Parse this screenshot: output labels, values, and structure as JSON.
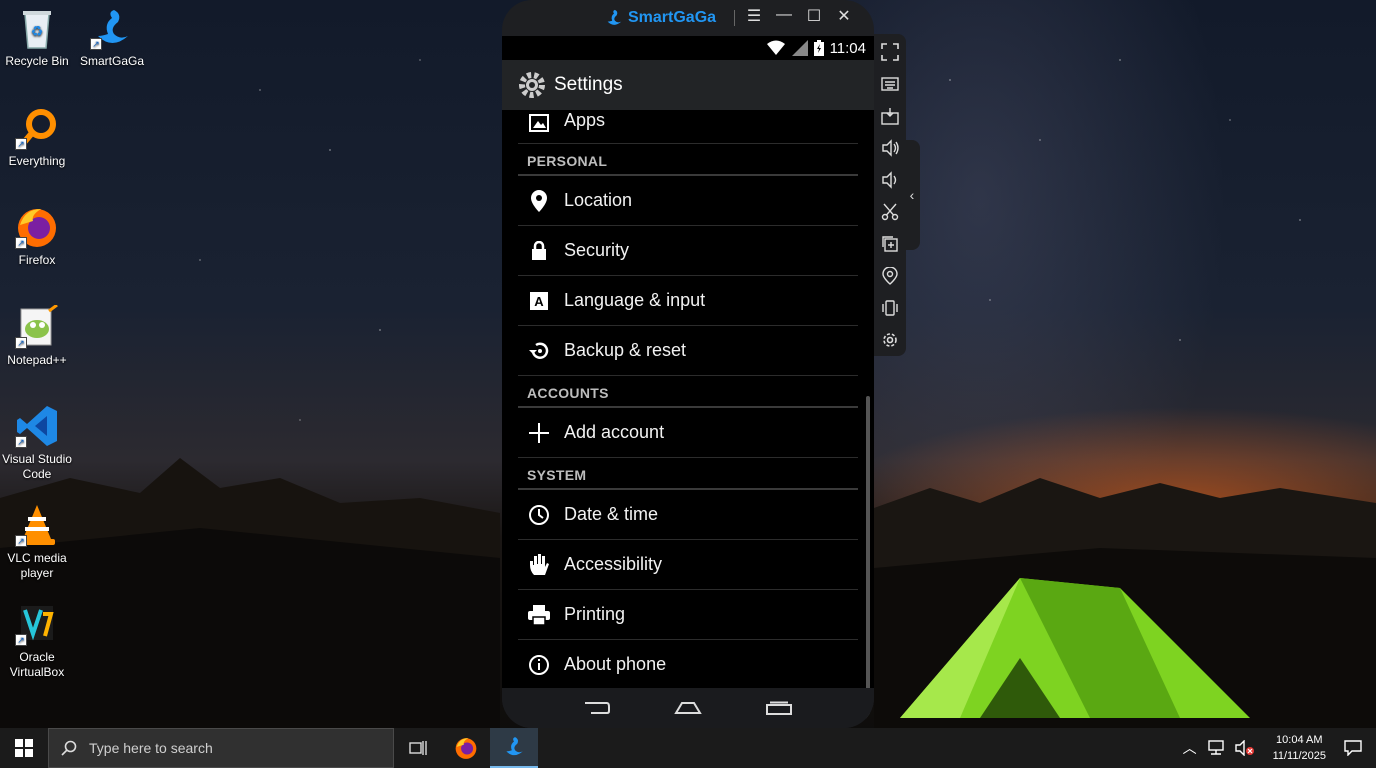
{
  "desktop": {
    "icons": [
      {
        "label": "Recycle Bin",
        "icon": "recycle-bin-icon"
      },
      {
        "label": "SmartGaGa",
        "icon": "smartgaga-swan-icon"
      },
      {
        "label": "Everything",
        "icon": "everything-search-icon"
      },
      {
        "label": "Firefox",
        "icon": "firefox-icon"
      },
      {
        "label": "Notepad++",
        "icon": "notepadpp-icon"
      },
      {
        "label": "Visual Studio Code",
        "label_line1": "Visual Studio",
        "label_line2": "Code",
        "icon": "vscode-icon"
      },
      {
        "label": "VLC media player",
        "label_line1": "VLC media",
        "label_line2": "player",
        "icon": "vlc-icon"
      },
      {
        "label": "Oracle VirtualBox",
        "label_line1": "Oracle",
        "label_line2": "VirtualBox",
        "icon": "virtualbox-icon"
      }
    ]
  },
  "emulator": {
    "brand": "SmartGaGa",
    "controls": {
      "menu": "☰",
      "minimize": "—",
      "maximize": "☐",
      "close": "✕"
    },
    "status_time": "11:04",
    "screen_title": "Settings",
    "list": [
      {
        "type": "item",
        "label": "Apps",
        "icon": "apps-icon"
      },
      {
        "type": "section",
        "label": "PERSONAL"
      },
      {
        "type": "item",
        "label": "Location",
        "icon": "location-pin-icon"
      },
      {
        "type": "item",
        "label": "Security",
        "icon": "lock-icon"
      },
      {
        "type": "item",
        "label": "Language & input",
        "icon": "language-icon"
      },
      {
        "type": "item",
        "label": "Backup & reset",
        "icon": "backup-restore-icon"
      },
      {
        "type": "section",
        "label": "ACCOUNTS"
      },
      {
        "type": "item",
        "label": "Add account",
        "icon": "plus-icon"
      },
      {
        "type": "section",
        "label": "SYSTEM"
      },
      {
        "type": "item",
        "label": "Date & time",
        "icon": "clock-icon"
      },
      {
        "type": "item",
        "label": "Accessibility",
        "icon": "hand-icon"
      },
      {
        "type": "item",
        "label": "Printing",
        "icon": "printer-icon"
      },
      {
        "type": "item",
        "label": "About phone",
        "icon": "info-icon"
      }
    ],
    "side_toolbar": [
      "fullscreen-icon",
      "keyboard-icon",
      "apk-install-icon",
      "volume-up-icon",
      "volume-down-icon",
      "scissors-icon",
      "multi-instance-icon",
      "location-icon",
      "shake-icon",
      "settings-gear-icon"
    ]
  },
  "taskbar": {
    "search_placeholder": "Type here to search",
    "time": "10:04 AM",
    "date": "11/11/2025"
  },
  "colors": {
    "accent": "#2196f3",
    "taskbar": "#1b1b1b",
    "android_bg": "#000000",
    "tent": "#7ed321"
  }
}
